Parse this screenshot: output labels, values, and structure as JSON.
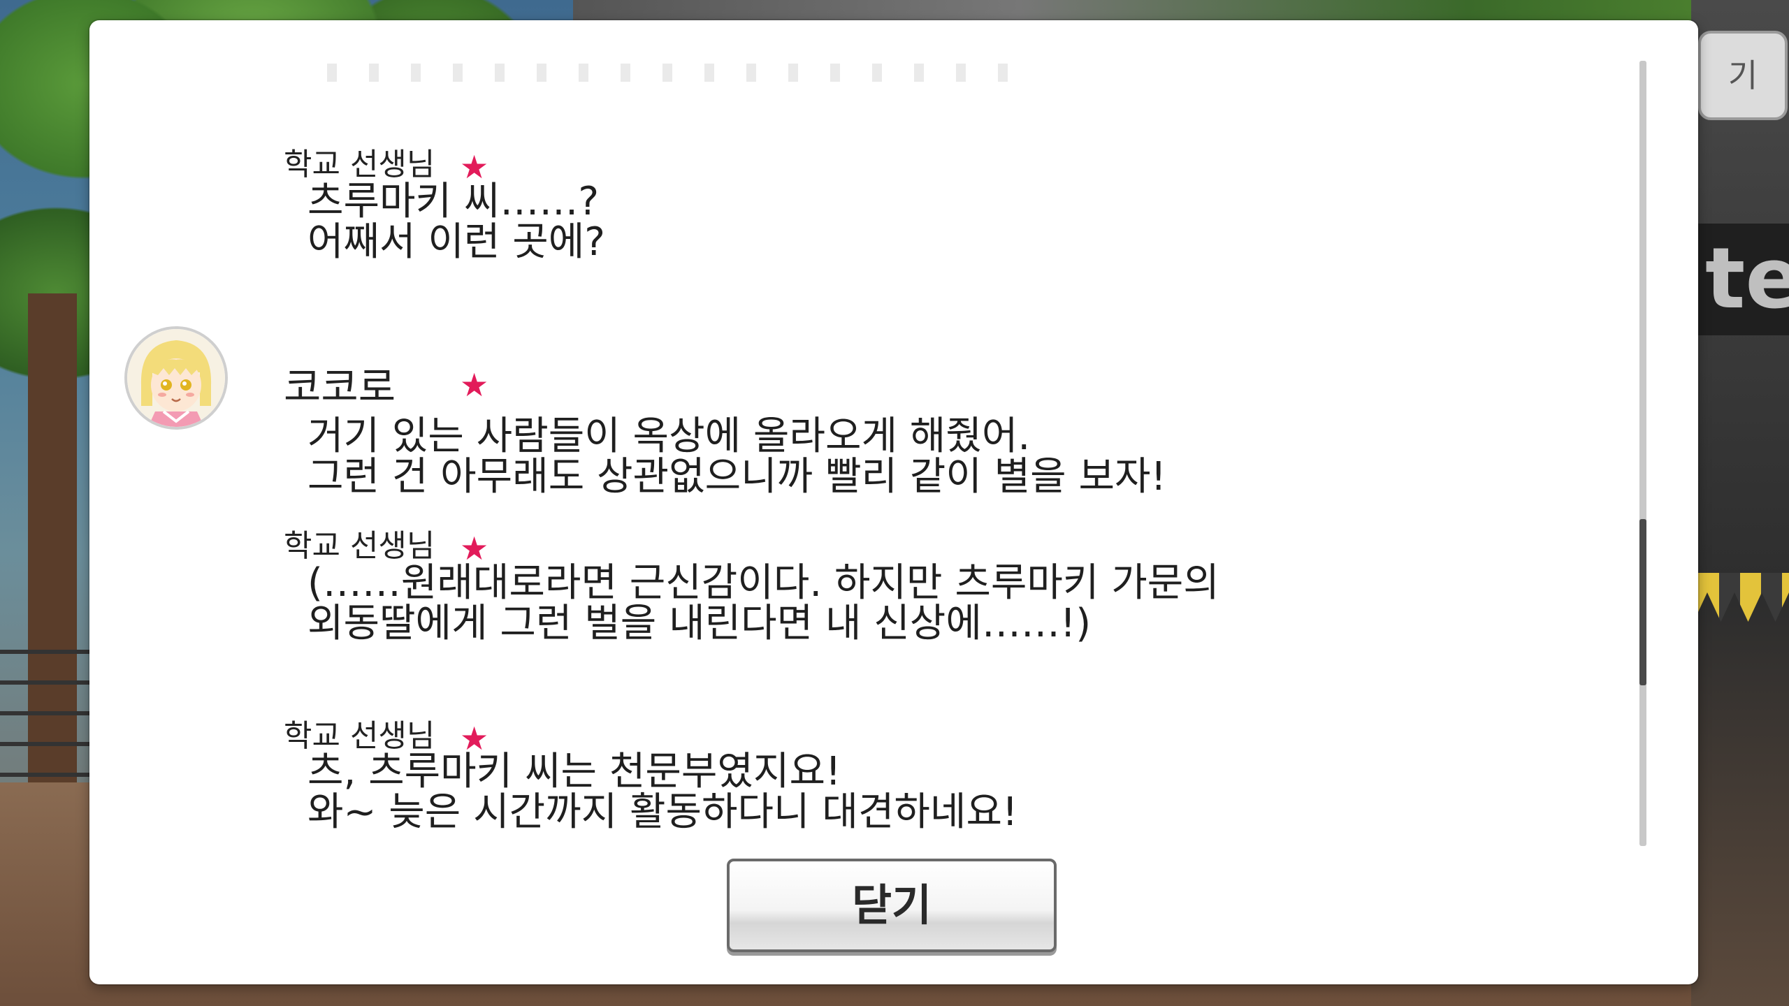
{
  "background": {
    "top_right_button_label": "기",
    "sign_text": "te"
  },
  "log": {
    "entries": [
      {
        "speaker": "학교 선생님",
        "lines": [
          "츠루마키 씨……?",
          "어째서 이런 곳에?"
        ]
      },
      {
        "speaker": "코코로",
        "has_avatar": true,
        "lines": [
          "거기 있는 사람들이 옥상에 올라오게 해줬어.",
          "그런 건 아무래도 상관없으니까 빨리 같이 별을 보자!"
        ]
      },
      {
        "speaker": "학교 선생님",
        "lines": [
          "(……원래대로라면 근신감이다. 하지만 츠루마키 가문의",
          "외동딸에게 그런 벌을 내린다면 내 신상에……!)"
        ]
      },
      {
        "speaker": "학교 선생님",
        "lines": [
          "츠, 츠루마키 씨는 천문부였지요!",
          "와~ 늦은 시간까지 활동하다니 대견하네요!"
        ]
      }
    ],
    "star_color": "#e21b5a",
    "scroll_position": 0.74
  },
  "close_button": {
    "label": "닫기"
  }
}
